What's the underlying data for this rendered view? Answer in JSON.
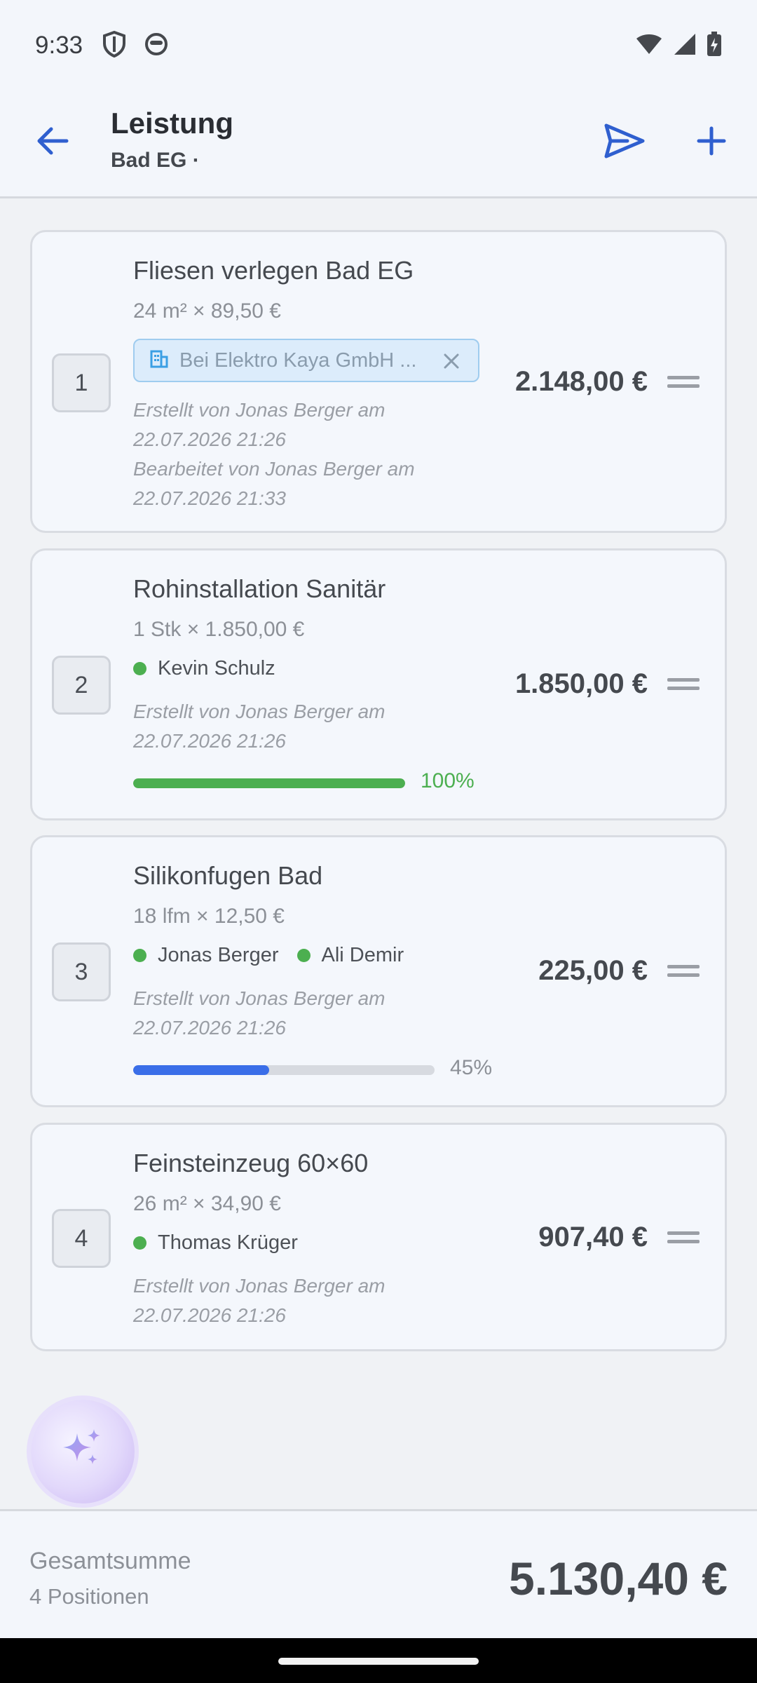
{
  "status_bar": {
    "time": "9:33",
    "icons": [
      "shield-icon",
      "face-icon",
      "wifi-icon",
      "signal-icon",
      "battery-charging-icon"
    ]
  },
  "app_bar": {
    "title": "Leistung",
    "subtitle": "Bad EG ·",
    "icons": [
      "back-arrow-icon",
      "send-icon",
      "plus-icon"
    ]
  },
  "colors": {
    "accent": "#2f5fcf",
    "success": "#4caf50",
    "progress_blue": "#3a6ee8",
    "chip_blue": "#3b9fe4"
  },
  "positions": [
    {
      "number": "1",
      "title": "Fliesen verlegen Bad EG",
      "quantity": "24 m² × 89,50 €",
      "company_chip": "Bei Elektro Kaya GmbH ...",
      "meta_lines": [
        "Erstellt von Jonas Berger am",
        "22.07.2026 21:26",
        "Bearbeitet von Jonas Berger am",
        "22.07.2026 21:33"
      ],
      "price": "2.148,00 €"
    },
    {
      "number": "2",
      "title": "Rohinstallation Sanitär",
      "quantity": "1 Stk × 1.850,00 €",
      "assignees": [
        "Kevin Schulz"
      ],
      "meta_lines": [
        "Erstellt von Jonas Berger am",
        "22.07.2026 21:26"
      ],
      "price": "1.850,00 €",
      "progress": 1.0,
      "progress_label": "100%"
    },
    {
      "number": "3",
      "title": "Silikonfugen Bad",
      "quantity": "18 lfm × 12,50 €",
      "assignees": [
        "Jonas Berger",
        "Ali Demir"
      ],
      "meta_lines": [
        "Erstellt von Jonas Berger am",
        "22.07.2026 21:26"
      ],
      "price": "225,00 €",
      "progress": 0.45,
      "progress_label": "45%"
    },
    {
      "number": "4",
      "title": "Feinsteinzeug 60×60",
      "quantity": "26 m² × 34,90 €",
      "assignees": [
        "Thomas Krüger"
      ],
      "meta_lines": [
        "Erstellt von Jonas Berger am",
        "22.07.2026 21:26"
      ],
      "price": "907,40 €"
    }
  ],
  "ai_button": {
    "icon": "sparkle-icon"
  },
  "footer": {
    "label": "Gesamtsumme",
    "count": "4 Positionen",
    "total": "5.130,40 €"
  }
}
